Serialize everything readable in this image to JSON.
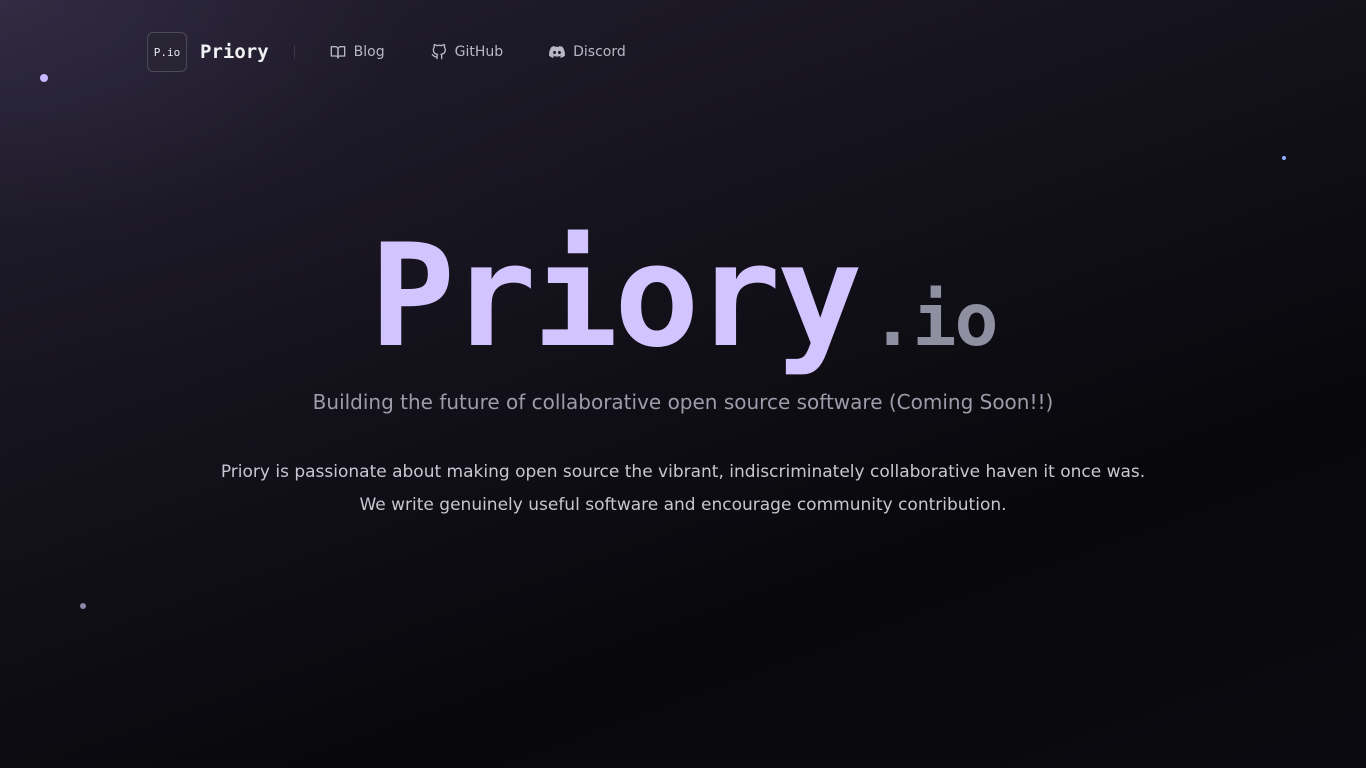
{
  "nav": {
    "logo_text": "P.io",
    "brand_name": "Priory",
    "links": [
      {
        "label": "Blog",
        "icon": "book-icon"
      },
      {
        "label": "GitHub",
        "icon": "github-icon"
      },
      {
        "label": "Discord",
        "icon": "discord-icon"
      }
    ]
  },
  "hero": {
    "title": "Priory",
    "title_suffix": ".io",
    "tagline": "Building the future of collaborative open source software (Coming Soon!!)",
    "description_lines": [
      "Priory is passionate about making open source the vibrant, indiscriminately collaborative haven it once was.",
      "We write genuinely useful software and encourage community contribution."
    ]
  },
  "colors": {
    "accent": "#d2c4ff",
    "muted": "#8f8fa2",
    "background": "#0b0b10"
  }
}
